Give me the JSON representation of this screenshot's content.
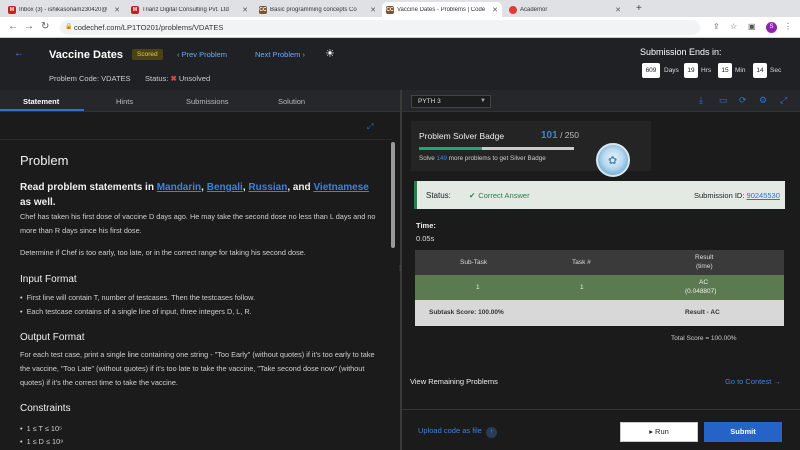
{
  "browser": {
    "tabs": [
      {
        "title": "Inbox (3) - ishikasonam230420@",
        "icon": "gmail-icon",
        "color": "#c5221f",
        "glyph": "M"
      },
      {
        "title": "Trianz Digital Consulting Pvt. Ltd",
        "icon": "gmail-icon",
        "color": "#c5221f",
        "glyph": "M"
      },
      {
        "title": "Basic programming concepts Co",
        "icon": "codechef-icon",
        "color": "#7a5230",
        "glyph": "CC"
      },
      {
        "title": "Vaccine Dates - Problems | Code",
        "icon": "codechef-icon",
        "color": "#7a5230",
        "glyph": "CC"
      },
      {
        "title": "Academor",
        "icon": "academor-icon",
        "color": "#e53935",
        "glyph": "●"
      }
    ],
    "new_tab": "+",
    "url": "codechef.com/LP1TO201/problems/VDATES",
    "profile_initial": "S"
  },
  "header": {
    "title": "Vaccine Dates",
    "scored_badge": "Scored",
    "prev": "Prev Problem",
    "next": "Next Problem",
    "problem_code_label": "Problem Code: VDATES",
    "status_label": "Status:",
    "status_value": "Unsolved",
    "submission_ends_label": "Submission Ends in:",
    "timer": [
      {
        "value": "609",
        "unit": "Days"
      },
      {
        "value": "19",
        "unit": "Hrs"
      },
      {
        "value": "15",
        "unit": "Min"
      },
      {
        "value": "14",
        "unit": "Sec"
      }
    ]
  },
  "left_tabs": [
    "Statement",
    "Hints",
    "Submissions",
    "Solution"
  ],
  "statement": {
    "heading": "Problem",
    "read_prefix": "Read problem statements in",
    "langs": [
      "Mandarin",
      "Bengali",
      "Russian",
      "Vietnamese"
    ],
    "read_and": "and",
    "read_suffix": "as well.",
    "p1": "Chef has taken his first dose of vaccine D days ago. He may take the second dose no less than L days and no more than R days since his first dose.",
    "p2": "Determine if Chef is too early, too late, or in the correct range for taking his second dose.",
    "input_heading": "Input Format",
    "input_items": [
      "First line will contain T, number of testcases. Then the testcases follow.",
      "Each testcase contains of a single line of input, three integers D, L, R."
    ],
    "output_heading": "Output Format",
    "output_text": "For each test case, print a single line containing one string - \"Too Early\" (without quotes) if it's too early to take the vaccine, \"Too Late\" (without quotes) if it's too late to take the vaccine, \"Take second dose now\" (without quotes) if it's the correct time to take the vaccine.",
    "constraints_heading": "Constraints",
    "constraints": [
      "1 ≤ T ≤ 10⁵",
      "1 ≤ D ≤ 10⁹"
    ]
  },
  "editor": {
    "language": "PYTH 3"
  },
  "badge": {
    "title": "Problem Solver Badge",
    "solved": "101",
    "total": "/ 250",
    "progress": 0.404,
    "sub_prefix": "Solve",
    "sub_count": "149",
    "sub_suffix": "more problems to get Silver Badge"
  },
  "result": {
    "status_label": "Status:",
    "status_value": "Correct Answer",
    "submission_id_label": "Submission ID:",
    "submission_id": "90245530",
    "time_label": "Time:",
    "time_value": "0.05s",
    "table_headers": [
      "Sub-Task",
      "Task #",
      "Result",
      "(time)"
    ],
    "row": {
      "subtask": "1",
      "task": "1",
      "result": "AC",
      "time": "(0.048807)"
    },
    "subtask_score": "Subtask Score: 100.00%",
    "result_summary": "Result - AC",
    "total_score": "Total Score = 100.00%"
  },
  "actions": {
    "view_remaining": "View Remaining Problems",
    "go_to_contest": "Go to Contest",
    "upload": "Upload code as file",
    "run": "Run",
    "submit": "Submit"
  }
}
